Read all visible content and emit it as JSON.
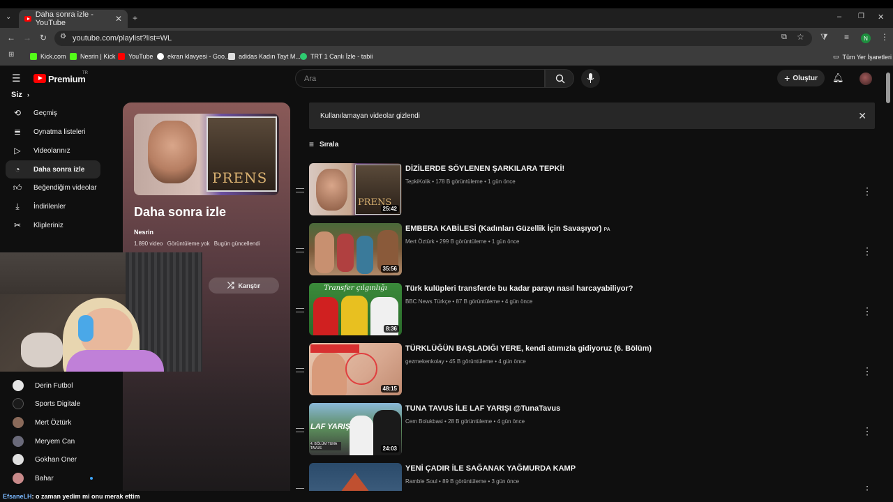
{
  "browser": {
    "tab_title": "Daha sonra izle - YouTube",
    "url": "youtube.com/playlist?list=WL",
    "bookmarks": [
      "Kick.com",
      "Nesrin | Kick",
      "YouTube",
      "ekran klavyesi - Goo...",
      "adidas Kadın Tayt M...",
      "TRT 1 Canlı İzle - tabii"
    ],
    "all_bookmarks": "Tüm Yer İşaretleri",
    "profile_initial": "N"
  },
  "header": {
    "logo": "Premium",
    "region": "TR",
    "search_placeholder": "Ara",
    "create_label": "Oluştur"
  },
  "sidebar": {
    "section": "Siz",
    "items": [
      "Geçmiş",
      "Oynatma listeleri",
      "Videolarınız",
      "Daha sonra izle",
      "Beğendiğim videolar",
      "İndirilenler",
      "Klipleriniz"
    ],
    "subscriptions": [
      "Derin Futbol",
      "Sports Digitale",
      "Mert Öztürk",
      "Meryem Can",
      "Gokhan Oner",
      "Bahar"
    ]
  },
  "playlist": {
    "title": "Daha sonra izle",
    "owner": "Nesrin",
    "video_count": "1.890 video",
    "views": "Görüntüleme yok",
    "updated": "Bugün güncellendi",
    "shuffle_label": "Karıştır",
    "thumb_text": "PRENS"
  },
  "main": {
    "banner": "Kullanılamayan videolar gizlendi",
    "sort_label": "Sırala",
    "videos": [
      {
        "title": "DİZİLERDE SÖYLENEN ŞARKILARA TEPKİ!",
        "channel": "TepkiKolik",
        "views": "178 B görüntüleme",
        "age": "1 gün önce",
        "duration": "25:42",
        "badge": ""
      },
      {
        "title": "EMBERA KABİLESİ (Kadınları Güzellik İçin Savaşıyor)",
        "channel": "Mert Öztürk",
        "views": "299 B görüntüleme",
        "age": "1 gün önce",
        "duration": "35:56",
        "badge": "PA"
      },
      {
        "title": "Türk kulüpleri transferde bu kadar parayı nasıl harcayabiliyor?",
        "channel": "BBC News Türkçe",
        "views": "87 B görüntüleme",
        "age": "4 gün önce",
        "duration": "8:36",
        "badge": ""
      },
      {
        "title": "TÜRKLÜĞÜN BAŞLADIĞI YERE, kendi atımızla gidiyoruz (6. Bölüm)",
        "channel": "gezmekenkolay",
        "views": "45 B görüntüleme",
        "age": "4 gün önce",
        "duration": "48:15",
        "badge": ""
      },
      {
        "title": "TUNA TAVUS İLE LAF YARIŞI @TunaTavus",
        "channel": "Cem Bolukbasi",
        "views": "28 B görüntüleme",
        "age": "4 gün önce",
        "duration": "24:03",
        "badge": ""
      },
      {
        "title": "YENİ ÇADIR İLE SAĞANAK YAĞMURDA KAMP",
        "channel": "Ramble Soul",
        "views": "89 B görüntüleme",
        "age": "3 gün önce",
        "duration": "",
        "badge": ""
      }
    ],
    "thumb_texts": [
      "Transfer çılgınlığı",
      "LAF YARIŞI",
      "4. BÖLÜM TUNA TAVUS"
    ]
  },
  "chat": {
    "user": "EfsaneLH",
    "message": ": o zaman yedim mi onu merak ettim"
  },
  "colors": {
    "accent": "#ff0000",
    "background": "#0f0f0f",
    "panel": "#272727"
  }
}
